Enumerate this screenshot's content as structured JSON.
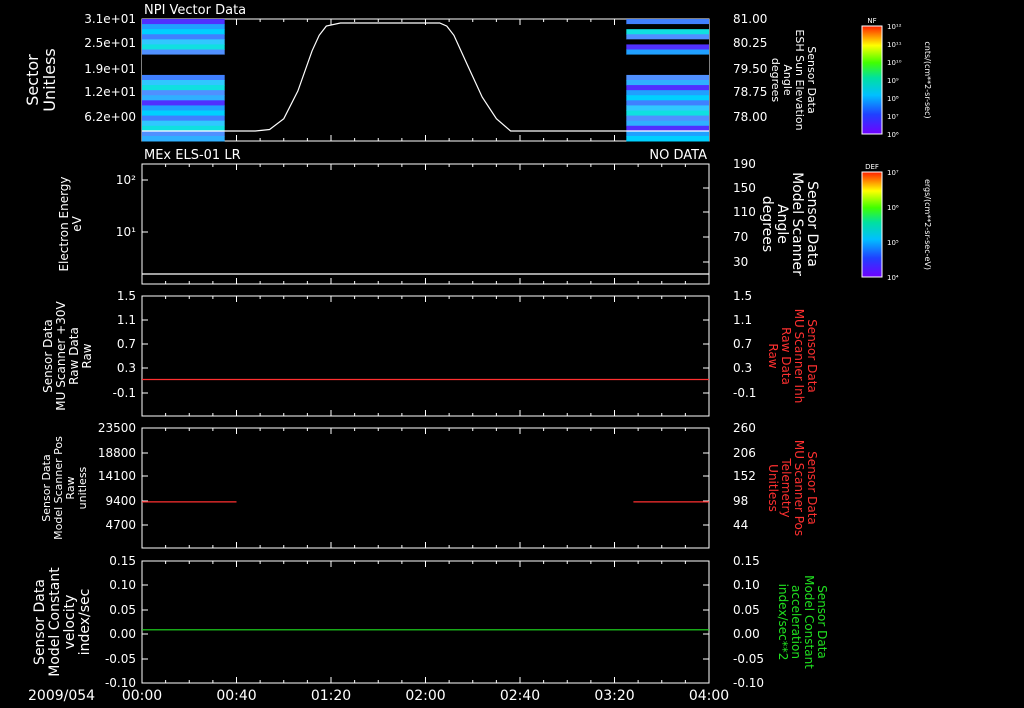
{
  "date_label": "2009/054",
  "x_ticks": [
    "00:00",
    "00:40",
    "01:20",
    "02:00",
    "02:40",
    "03:20",
    "04:00"
  ],
  "colors": {
    "red": "#ff3030",
    "green": "#20e020",
    "white": "#ffffff"
  },
  "colorbars": [
    {
      "tag": "NF",
      "min_label": "10⁶",
      "max_label": "10¹²",
      "ticks": [
        "10¹²",
        "10¹¹",
        "10¹⁰",
        "10⁹",
        "10⁸",
        "10⁷",
        "10⁶"
      ],
      "unit": "cnts/(cm**2-sr-sec)"
    },
    {
      "tag": "DEF",
      "min_label": "10⁴",
      "max_label": "10⁷",
      "ticks": [
        "10⁷",
        "10⁶",
        "10⁵",
        "10⁴"
      ],
      "unit": "ergs/(cm**2-sr-sec-eV)"
    }
  ],
  "chart_data": [
    {
      "type": "heatmap",
      "title": "NPI Vector Data",
      "ylabel_left": [
        "Sector",
        "Unitless"
      ],
      "left_ticks": [
        "3.1e+01",
        "2.5e+01",
        "1.9e+01",
        "1.2e+01",
        "6.2e+00"
      ],
      "ylabel_right": [
        "Sensor Data",
        "ESH Sun Elevation",
        "Angle",
        "degrees"
      ],
      "right_ticks": [
        "81.00",
        "80.25",
        "79.50",
        "78.75",
        "78.00"
      ],
      "ylim_right": [
        77.5,
        81.0
      ],
      "heatmap_time_ranges_hours": [
        [
          0.0,
          0.5833
        ],
        [
          3.4167,
          4.0
        ]
      ],
      "series": [
        {
          "color": "white",
          "x": [
            0.0,
            0.8,
            0.9,
            1.0,
            1.1,
            1.2,
            1.25,
            1.3,
            1.4,
            1.6,
            1.8,
            2.0,
            2.1,
            2.15,
            2.2,
            2.3,
            2.4,
            2.5,
            2.6,
            4.0
          ],
          "y": [
            77.5,
            77.5,
            77.55,
            77.9,
            78.8,
            80.1,
            80.6,
            80.9,
            81.0,
            81.0,
            81.0,
            81.0,
            81.0,
            80.9,
            80.6,
            79.6,
            78.6,
            77.9,
            77.5,
            77.5
          ]
        }
      ]
    },
    {
      "type": "line",
      "title": "MEx ELS-01 LR",
      "status": "NO DATA",
      "ylabel_left": [
        "Electron Energy",
        "eV"
      ],
      "left_ticks": [
        "10²",
        "10¹"
      ],
      "ylabel_right": [
        "Sensor Data",
        "Model Scanner",
        "Angle",
        "degrees"
      ],
      "right_ticks": [
        "190",
        "150",
        "110",
        "70",
        "30"
      ],
      "ylim_right": [
        10,
        190
      ],
      "series": [
        {
          "color": "white",
          "x": [
            0.0,
            4.0
          ],
          "y": [
            10.0,
            10.0
          ]
        }
      ]
    },
    {
      "type": "line",
      "ylabel_left": [
        "Sensor Data",
        "MU Scanner +30V",
        "Raw Data",
        "Raw"
      ],
      "left_ticks": [
        "1.5",
        "1.1",
        "0.7",
        "0.3",
        "-0.1"
      ],
      "ylabel_right": [
        "Sensor Data",
        "MU Scanner Inh",
        "Raw Data",
        "Raw"
      ],
      "right_ticks": [
        "1.5",
        "1.1",
        "0.7",
        "0.3",
        "-0.1"
      ],
      "ylabel_right_color": "red",
      "ylim": [
        -0.5,
        1.5
      ],
      "series": [
        {
          "color": "red",
          "x": [
            0.0,
            4.0
          ],
          "y": [
            0.0,
            0.0
          ]
        }
      ]
    },
    {
      "type": "line",
      "ylabel_left": [
        "Sensor Data",
        "Model Scanner Pos",
        "Raw",
        "unitless"
      ],
      "left_ticks": [
        "23500",
        "18800",
        "14100",
        "9400",
        "4700"
      ],
      "ylim": [
        0,
        23500
      ],
      "ylabel_right": [
        "Sensor Data",
        "MU Scanner Pos",
        "Telemetry",
        "Unitless"
      ],
      "right_ticks": [
        "260",
        "206",
        "152",
        "98",
        "44"
      ],
      "ylabel_right_color": "red",
      "series": [
        {
          "color": "red",
          "x": [
            0.0,
            0.6667
          ],
          "y": [
            8000,
            8000
          ]
        },
        {
          "color": "red",
          "x": [
            3.4667,
            4.0
          ],
          "y": [
            8000,
            8000
          ]
        }
      ]
    },
    {
      "type": "line",
      "ylabel_left": [
        "Sensor Data",
        "Model Constant",
        "velocity",
        "index/sec"
      ],
      "left_ticks": [
        "0.15",
        "0.10",
        "0.05",
        "0.00",
        "-0.05",
        "-0.10"
      ],
      "ylim": [
        -0.1,
        0.15
      ],
      "ylabel_right": [
        "Sensor Data",
        "Model Constant",
        "acceleration",
        "index/sec**2"
      ],
      "right_ticks": [
        "0.15",
        "0.10",
        "0.05",
        "0.00",
        "-0.05",
        "-0.10"
      ],
      "ylabel_right_color": "green",
      "series": [
        {
          "color": "green",
          "x": [
            0.0,
            4.0
          ],
          "y": [
            0.0,
            0.0
          ]
        }
      ]
    }
  ]
}
